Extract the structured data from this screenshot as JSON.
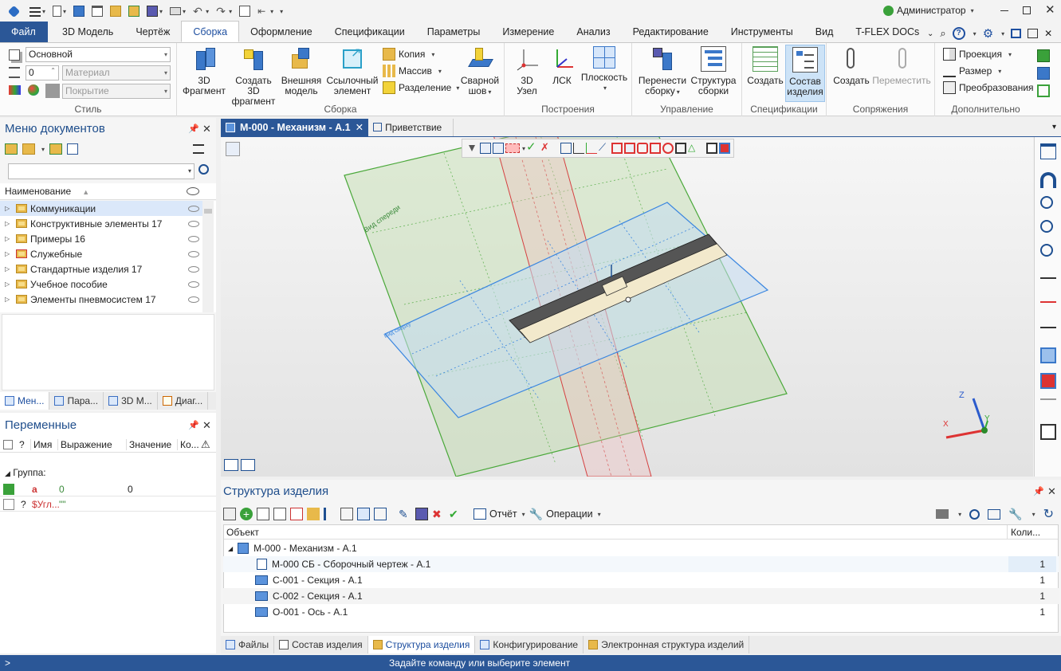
{
  "qat": {
    "user": "Администратор"
  },
  "menu": {
    "tabs": [
      "Файл",
      "3D Модель",
      "Чертёж",
      "Сборка",
      "Оформление",
      "Спецификации",
      "Параметры",
      "Измерение",
      "Анализ",
      "Редактирование",
      "Инструменты",
      "Вид",
      "T-FLEX DOCs"
    ],
    "active": "Сборка"
  },
  "ribbon": {
    "style": {
      "label": "Стиль",
      "layer": "Основной",
      "layer_num": "0",
      "material": "Материал",
      "coating": "Покрытие"
    },
    "assembly": {
      "label": "Сборка",
      "b1": "3D",
      "b1b": "Фрагмент",
      "b2": "Создать 3D",
      "b2b": "фрагмент",
      "b3": "Внешняя",
      "b3b": "модель",
      "b4": "Ссылочный",
      "b4b": "элемент",
      "copy": "Копия",
      "array": "Массив",
      "split": "Разделение",
      "b5": "Сварной",
      "b5b": "шов"
    },
    "construct": {
      "label": "Построения",
      "b1": "3D",
      "b1b": "Узел",
      "b2": "ЛСК",
      "b3": "Плоскость"
    },
    "manage": {
      "label": "Управление",
      "b1": "Перенести",
      "b1b": "сборку",
      "b2": "Структура",
      "b2b": "сборки"
    },
    "spec": {
      "label": "Спецификации",
      "b1": "Создать",
      "b2": "Состав",
      "b2b": "изделия"
    },
    "mate": {
      "label": "Сопряжения",
      "b1": "Создать",
      "b2": "Переместить"
    },
    "extra": {
      "label": "Дополнительно",
      "b1": "Проекция",
      "b2": "Размер",
      "b3": "Преобразования"
    }
  },
  "docmenu": {
    "title": "Меню документов",
    "col": "Наименование",
    "items": [
      "Коммуникации",
      "Конструктивные элементы 17",
      "Примеры 16",
      "Служебные",
      "Стандартные изделия 17",
      "Учебное пособие",
      "Элементы пневмосистем 17"
    ],
    "tabs": [
      "Мен...",
      "Пара...",
      "3D М...",
      "Диаг..."
    ]
  },
  "vars": {
    "title": "Переменные",
    "cols": [
      "?",
      "Имя",
      "Выражение",
      "Значение",
      "Ко..."
    ],
    "group": "Группа:",
    "rows": [
      {
        "name": "a",
        "expr": "0",
        "val": "0"
      },
      {
        "q": "?",
        "name": "$Угл...",
        "expr": "\"\"",
        "val": ""
      }
    ]
  },
  "doctabs": {
    "active": "М-000 - Механизм - А.1",
    "second": "Приветствие"
  },
  "viewport": {
    "front_label": "Вид спереди",
    "top_label": "Вид сверху",
    "axes": [
      "Z",
      "Y",
      "X"
    ]
  },
  "structure": {
    "title": "Структура изделия",
    "report": "Отчёт",
    "ops": "Операции",
    "col_obj": "Объект",
    "col_qty": "Коли...",
    "rows": [
      {
        "name": "М-000 - Механизм - А.1",
        "qty": ""
      },
      {
        "name": "М-000 СБ - Сборочный чертеж - А.1",
        "qty": "1"
      },
      {
        "name": "С-001 - Секция - А.1",
        "qty": "1"
      },
      {
        "name": "С-002 - Секция - А.1",
        "qty": "1"
      },
      {
        "name": "О-001 - Ось - А.1",
        "qty": "1"
      }
    ],
    "tabs": [
      "Файлы",
      "Состав изделия",
      "Структура изделия",
      "Конфигурирование",
      "Электронная структура изделий"
    ]
  },
  "status": {
    "prompt": ">",
    "message": "Задайте команду или выберите элемент"
  }
}
